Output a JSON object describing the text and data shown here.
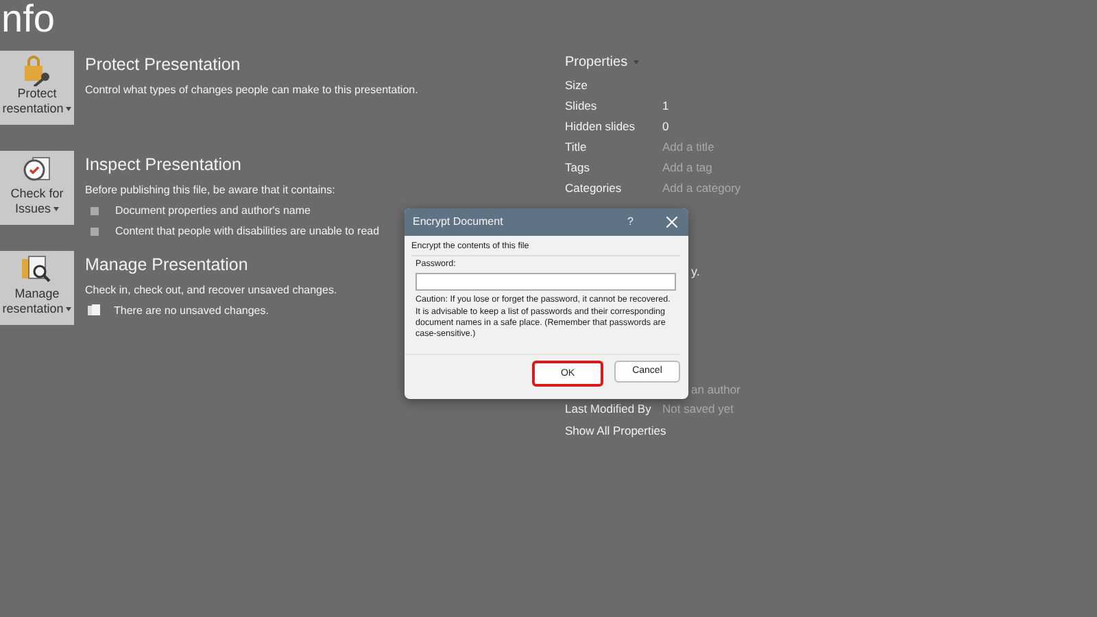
{
  "page_title": "nfo",
  "sections": [
    {
      "kind": "protect",
      "button": [
        "Protect",
        "resentation"
      ],
      "heading": "Protect Presentation",
      "description": "Control what types of changes people can make to this presentation."
    },
    {
      "kind": "inspect",
      "button": [
        "Check for",
        "Issues"
      ],
      "heading": "Inspect Presentation",
      "description": "Before publishing this file, be aware that it contains:",
      "items": [
        {
          "kind": "bullet",
          "text": "Document properties and author's name"
        },
        {
          "kind": "bullet",
          "text": "Content that people with disabilities are unable to read"
        }
      ]
    },
    {
      "kind": "manage",
      "button": [
        "Manage",
        "resentation"
      ],
      "heading": "Manage Presentation",
      "description": "Check in, check out, and recover unsaved changes.",
      "items": [
        {
          "kind": "status",
          "text": "There are no unsaved changes."
        }
      ]
    }
  ],
  "properties": {
    "heading": "Properties",
    "rows": [
      {
        "label": "Size"
      },
      {
        "label": "Slides",
        "value": "1",
        "muted": false
      },
      {
        "label": "Hidden slides",
        "value": "0",
        "muted": false
      },
      {
        "label": "Title",
        "value": "Add a title",
        "muted": true
      },
      {
        "label": "Tags",
        "value": "Add a tag",
        "muted": true
      },
      {
        "label": "Categories",
        "value": "Add a category",
        "muted": true
      }
    ],
    "partial_texts": [
      "y.",
      "an author"
    ],
    "last_modified": {
      "label": "Last Modified By",
      "value": "Not saved yet",
      "muted": true
    },
    "show_all": "Show All Properties"
  },
  "dialog": {
    "title": "Encrypt Document",
    "help": "?",
    "group_label": "Encrypt the contents of this file",
    "password_label": "Password:",
    "caution": "Caution: If you lose or forget the password, it cannot be recovered. It is advisable to keep a list of passwords and their corresponding document names in a safe place. (Remember that passwords are case-sensitive.)",
    "buttons": [
      {
        "label": "OK",
        "highlighted": true
      },
      {
        "label": "Cancel",
        "highlighted": false
      }
    ]
  }
}
